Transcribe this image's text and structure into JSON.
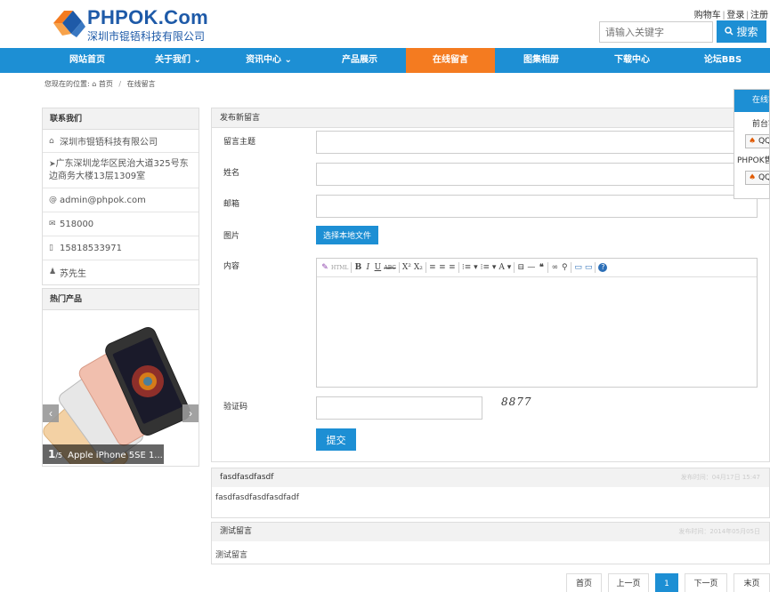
{
  "header": {
    "logo_title": "PHPOK.Com",
    "logo_subtitle": "深圳市锟铻科技有限公司",
    "top_links": [
      "购物车",
      "登录",
      "注册"
    ],
    "search_placeholder": "请输入关键字",
    "search_button": "搜索"
  },
  "nav": {
    "items": [
      {
        "label": "网站首页"
      },
      {
        "label": "关于我们 ⌄"
      },
      {
        "label": "资讯中心 ⌄"
      },
      {
        "label": "产品展示"
      },
      {
        "label": "在线留言"
      },
      {
        "label": "图集相册"
      },
      {
        "label": "下载中心"
      },
      {
        "label": "论坛BBS"
      }
    ]
  },
  "breadcrumb": {
    "prefix": "您现在的位置:",
    "home": "首页",
    "current": "在线留言"
  },
  "contact": {
    "title": "联系我们",
    "company": "深圳市锟铻科技有限公司",
    "address": "广东深圳龙华区民治大道325号东边商务大楼13层1309室",
    "email": "admin@phpok.com",
    "postcode": "518000",
    "phone": "15818533971",
    "person": "苏先生"
  },
  "hot_products": {
    "title": "热门产品",
    "current_index": "1",
    "total": "/5",
    "caption": "Apple iPhone 5SE 1..."
  },
  "form": {
    "title": "发布新留言",
    "labels": {
      "subject": "留言主题",
      "name": "姓名",
      "email": "邮箱",
      "image": "图片",
      "content": "内容",
      "captcha": "验证码"
    },
    "file_button": "选择本地文件",
    "captcha_text": "8877",
    "submit": "提交",
    "toolbar": [
      "✎",
      "HTML",
      "B",
      "I",
      "U",
      "ABC",
      "X²",
      "X₂",
      "≡",
      "≡",
      "≡",
      "⁝≡ ▾",
      "⁝≡ ▾",
      "A ▾",
      "⊟",
      "—",
      "❝",
      "∞",
      "⚲",
      "▭",
      "▭",
      "?"
    ]
  },
  "messages": [
    {
      "title": "fasdfasdfasdf",
      "time": "发布时间：04月17日 15:47",
      "body": "fasdfasdfasdfasdfadf"
    },
    {
      "title": "测试留言",
      "time": "发布时间：2014年05月05日",
      "body": "测试留言"
    }
  ],
  "pagination": {
    "first": "首页",
    "prev": "上一页",
    "current": "1",
    "next": "下一页",
    "last": "末页"
  },
  "online_service": {
    "title": "在线客服",
    "presales": "前台客服",
    "qq1": "QQ交谈",
    "phpok": "PHPOK售后",
    "qq2": "QQ交谈"
  },
  "colors": {
    "brand_blue": "#1d8fd4",
    "active_orange": "#f47b20",
    "logo_blue": "#1e5aa8"
  }
}
